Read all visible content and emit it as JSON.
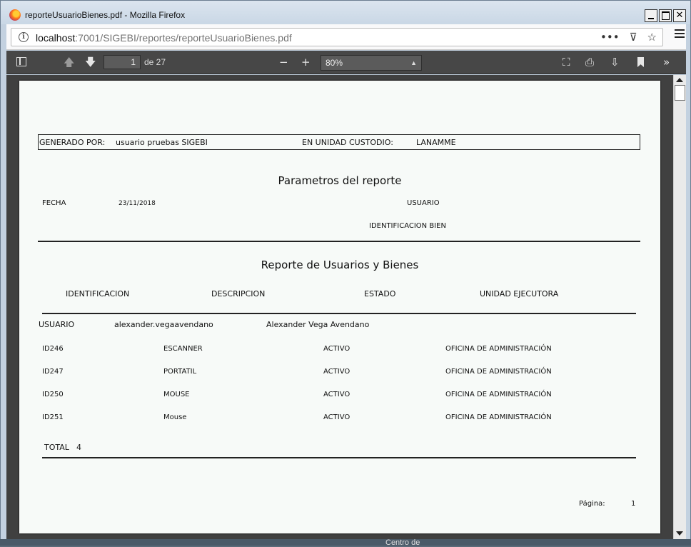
{
  "window": {
    "title": "reporteUsuarioBienes.pdf - Mozilla Firefox",
    "close_glyph": "✕"
  },
  "urlbar": {
    "host": "localhost",
    "path": ":7001/SIGEBI/reportes/reporteUsuarioBienes.pdf"
  },
  "pdf_toolbar": {
    "current_page": "1",
    "page_count_label": "de 27",
    "zoom": "80%"
  },
  "report": {
    "generated_by_label": "GENERADO POR:",
    "generated_by_value": "usuario pruebas SIGEBI",
    "unit_label": "EN UNIDAD CUSTODIO:",
    "unit_value": "LANAMME",
    "params_title": "Parametros del reporte",
    "fecha_label": "FECHA",
    "fecha_value": "23/11/2018",
    "usuario_label": "USUARIO",
    "identificacion_bien_label": "IDENTIFICACION BIEN",
    "report_title": "Reporte de Usuarios y Bienes",
    "columns": [
      "IDENTIFICACION",
      "DESCRIPCION",
      "ESTADO",
      "UNIDAD EJECUTORA"
    ],
    "user_row": {
      "label": "USUARIO",
      "username": "alexander.vegaavendano",
      "fullname": "Alexander Vega Avendano"
    },
    "rows": [
      {
        "id": "ID246",
        "desc": "ESCANNER",
        "estado": "ACTIVO",
        "unidad": "OFICINA DE ADMINISTRACIÓN"
      },
      {
        "id": "ID247",
        "desc": "PORTATIL",
        "estado": "ACTIVO",
        "unidad": "OFICINA DE ADMINISTRACIÓN"
      },
      {
        "id": "ID250",
        "desc": "MOUSE",
        "estado": "ACTIVO",
        "unidad": "OFICINA DE ADMINISTRACIÓN"
      },
      {
        "id": "ID251",
        "desc": "Mouse",
        "estado": "ACTIVO",
        "unidad": "OFICINA DE ADMINISTRACIÓN"
      }
    ],
    "total_label": "TOTAL",
    "total_value": "4",
    "page_label": "Página:",
    "page_value": "1"
  },
  "background": {
    "taskbar_text": "Centro de"
  },
  "icons": {
    "browser_logo": "firefox-logo-icon",
    "site_info": "info-icon",
    "page_actions": "more-icon",
    "pocket": "pocket-icon",
    "bookmark_star": "star-icon",
    "menu": "hamburger-menu-icon",
    "sidebar": "sidebar-toggle-icon",
    "prev": "arrow-up-icon",
    "next": "arrow-down-icon",
    "zoom_out": "minus-icon",
    "zoom_in": "plus-icon",
    "presentation": "fullscreen-icon",
    "print": "print-icon",
    "download": "download-icon",
    "bookmark": "bookmark-icon",
    "tools": "double-chevron-icon"
  }
}
